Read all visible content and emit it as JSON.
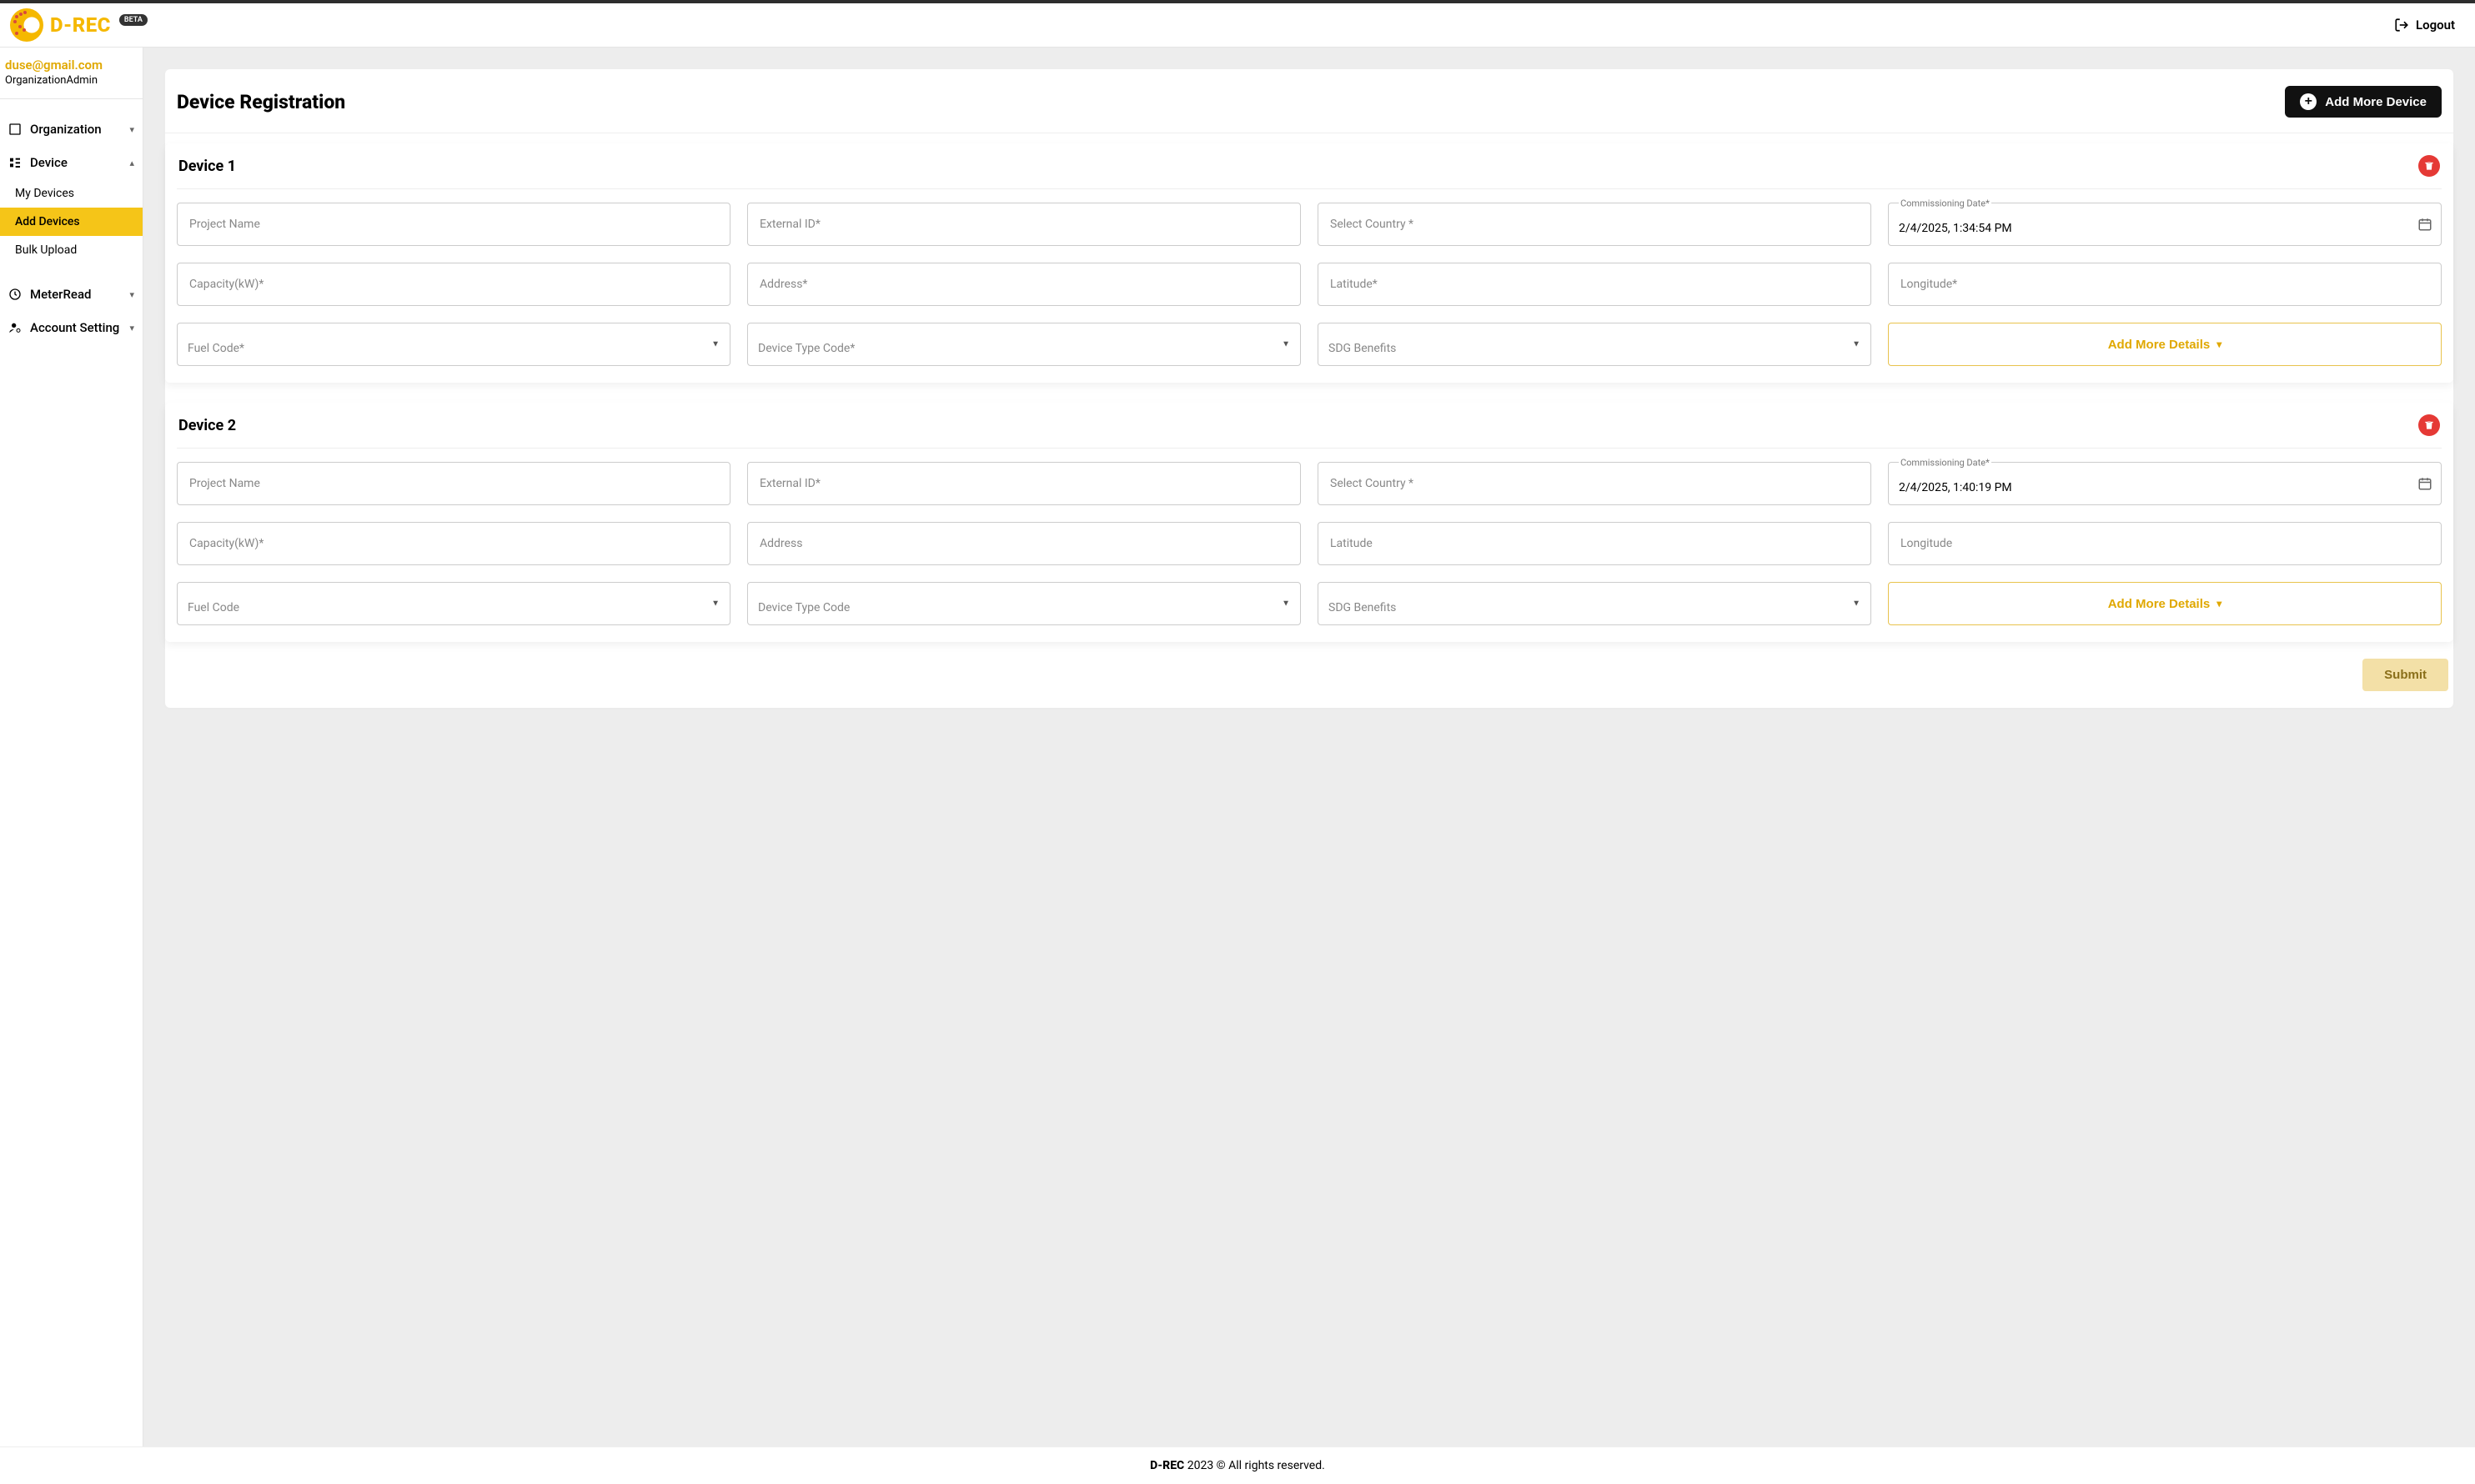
{
  "brand": {
    "name": "D-REC",
    "badge": "BETA"
  },
  "header": {
    "logout": "Logout"
  },
  "user": {
    "email": "duse@gmail.com",
    "role": "OrganizationAdmin"
  },
  "nav": {
    "organization": "Organization",
    "device": "Device",
    "device_sub": {
      "my_devices": "My Devices",
      "add_devices": "Add Devices",
      "bulk_upload": "Bulk Upload"
    },
    "meterread": "MeterRead",
    "account_setting": "Account Setting"
  },
  "page": {
    "title": "Device Registration",
    "add_more": "Add More Device",
    "add_details": "Add More Details",
    "submit": "Submit"
  },
  "labels": {
    "project_name": "Project Name",
    "external_id_req": "External ID*",
    "select_country_req": "Select Country *",
    "commissioning_date_req": "Commissioning Date*",
    "capacity_req": "Capacity(kW)*",
    "address_req": "Address*",
    "address": "Address",
    "latitude_req": "Latitude*",
    "latitude": "Latitude",
    "longitude_req": "Longitude*",
    "longitude": "Longitude",
    "fuel_code_req": "Fuel Code*",
    "fuel_code": "Fuel Code",
    "device_type_code_req": "Device Type Code*",
    "device_type_code": "Device Type Code",
    "sdg_benefits": "SDG Benefits"
  },
  "devices": [
    {
      "title": "Device 1",
      "commissioning_date": "2/4/2025, 1:34:54 PM"
    },
    {
      "title": "Device 2",
      "commissioning_date": "2/4/2025, 1:40:19 PM"
    }
  ],
  "footer": {
    "brand": "D-REC",
    "rest": " 2023 © All rights reserved."
  }
}
